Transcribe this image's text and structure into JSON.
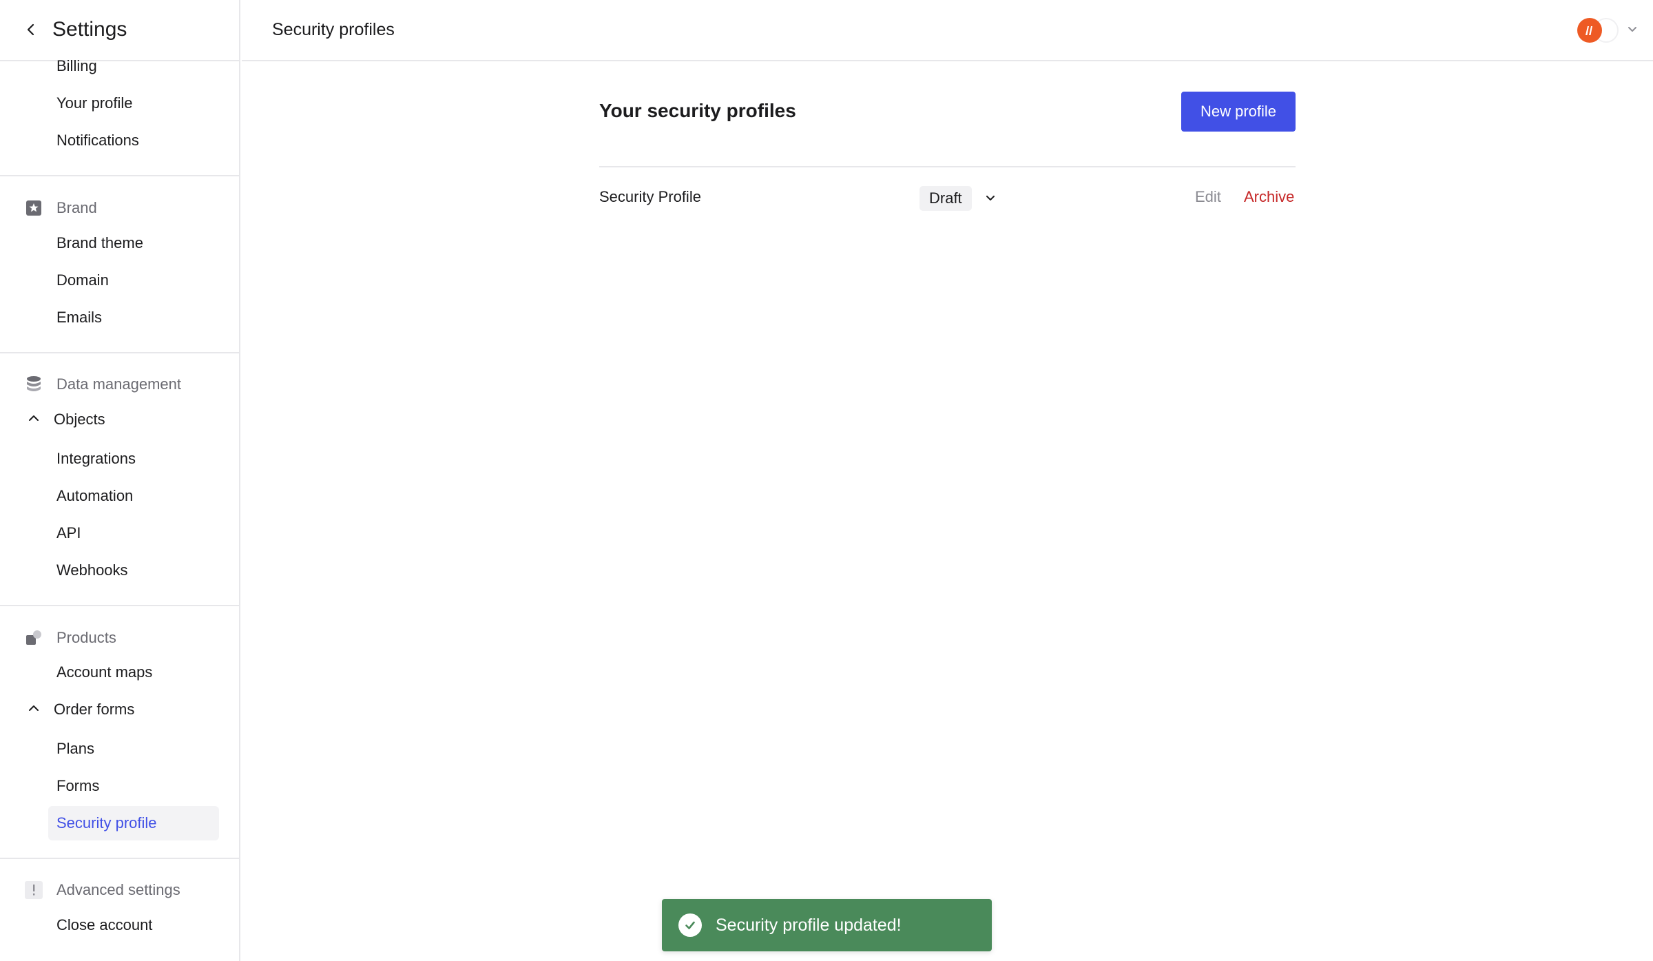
{
  "sidebar": {
    "title": "Settings",
    "account_items": [
      "Billing",
      "Your profile",
      "Notifications"
    ],
    "brand": {
      "heading": "Brand",
      "items": [
        "Brand theme",
        "Domain",
        "Emails"
      ]
    },
    "data_management": {
      "heading": "Data management",
      "objects_label": "Objects",
      "items": [
        "Integrations",
        "Automation",
        "API",
        "Webhooks"
      ]
    },
    "products": {
      "heading": "Products",
      "account_maps": "Account maps",
      "order_forms_label": "Order forms",
      "items": [
        "Plans",
        "Forms",
        "Security profile"
      ]
    },
    "advanced": {
      "heading": "Advanced settings",
      "items": [
        "Close account"
      ]
    }
  },
  "header": {
    "title": "Security profiles"
  },
  "main": {
    "heading": "Your security profiles",
    "new_button": "New profile",
    "rows": [
      {
        "name": "Security Profile",
        "status": "Draft",
        "edit": "Edit",
        "archive": "Archive"
      }
    ]
  },
  "toast": {
    "message": "Security profile updated!"
  },
  "colors": {
    "accent": "#4150e6",
    "danger": "#c62828",
    "success": "#4a8a5a"
  }
}
